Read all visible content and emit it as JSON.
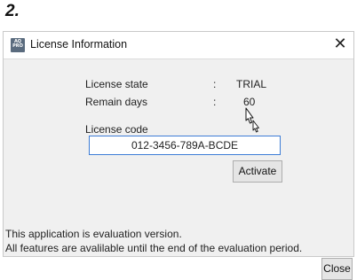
{
  "step_label": "2.",
  "window": {
    "title": "License Information",
    "icon_text": "AQ PRO"
  },
  "info": {
    "state_label": "License state",
    "state_value": "TRIAL",
    "remain_label": "Remain days",
    "remain_value": "60",
    "separator": ":"
  },
  "license_code": {
    "label": "License code",
    "value": "012-3456-789A-BCDE"
  },
  "buttons": {
    "activate": "Activate",
    "close": "Close"
  },
  "message": {
    "line1": "This application is evaluation version.",
    "line2": "All features are avalilable until the end of the evaluation period."
  },
  "icons": {
    "app": "app-icon",
    "close": "close-icon",
    "cursor": "mouse-pointer-icon"
  }
}
